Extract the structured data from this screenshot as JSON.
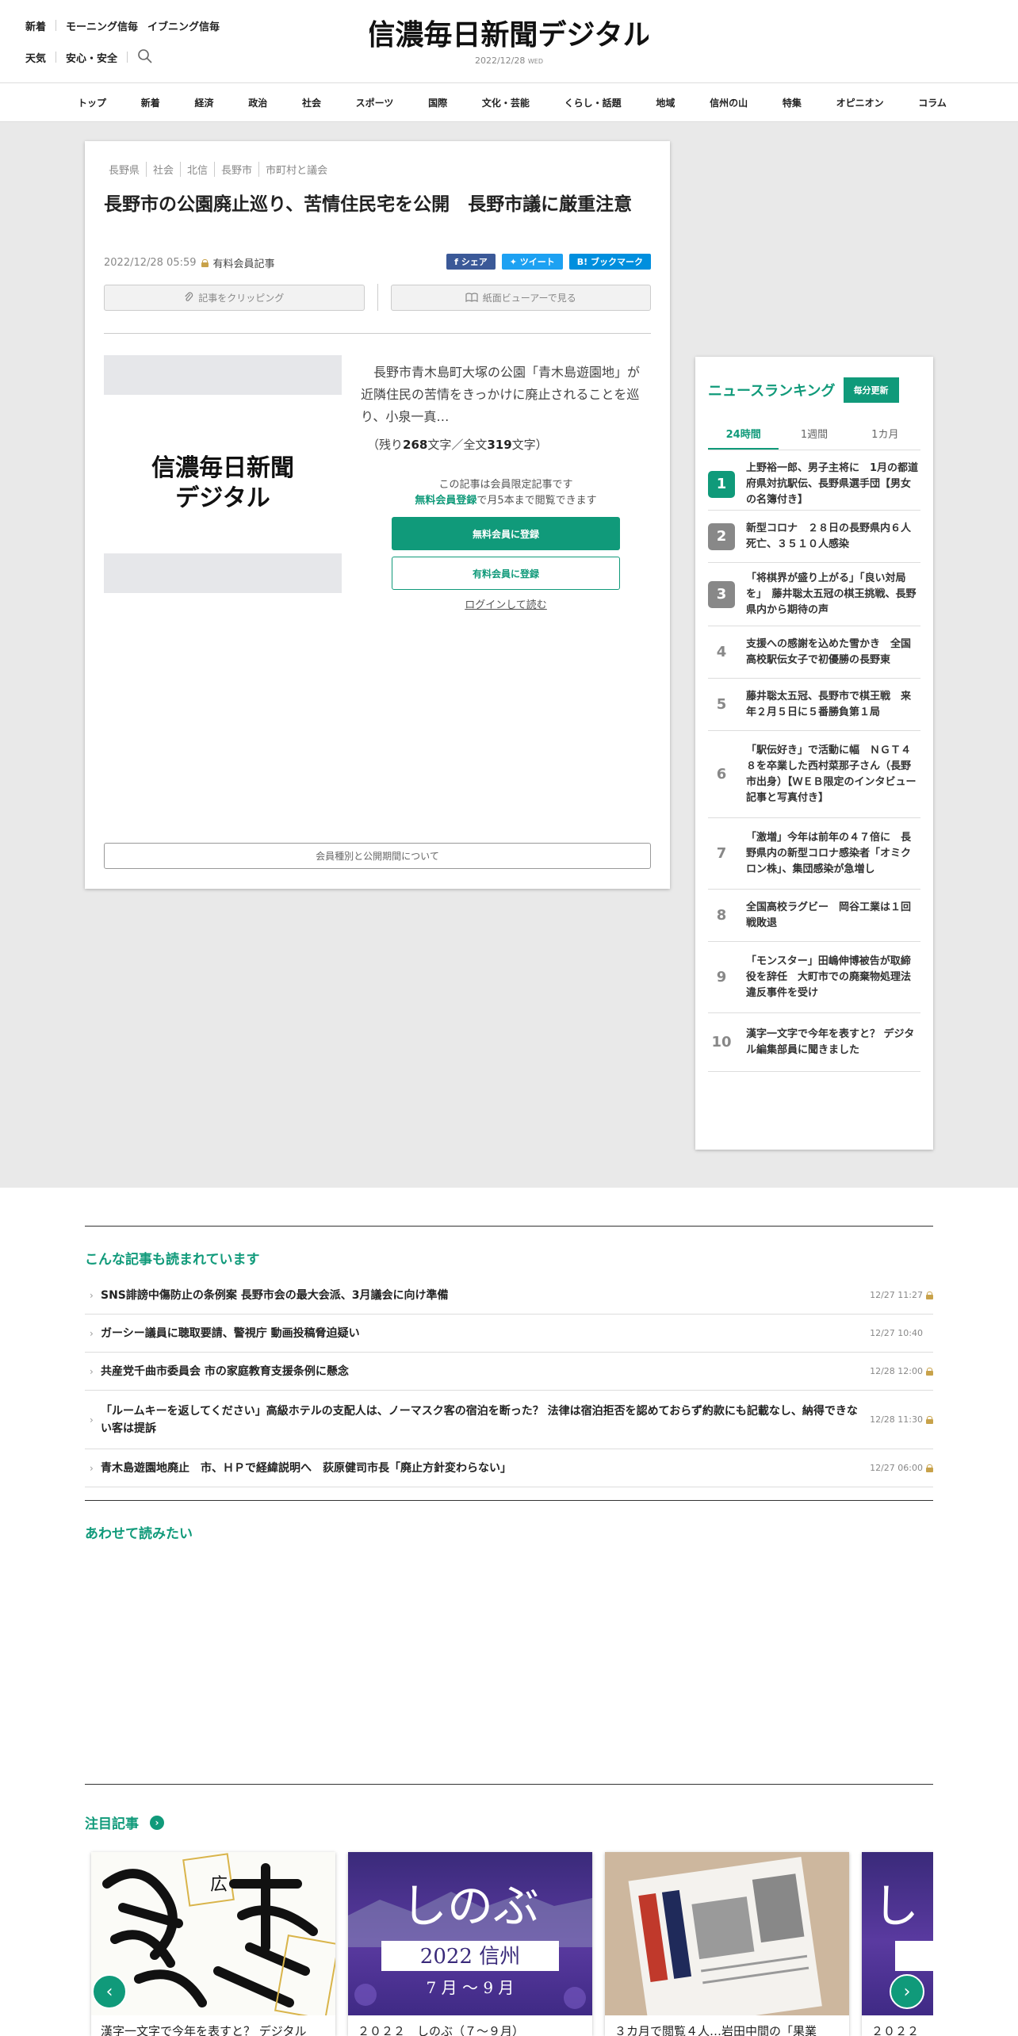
{
  "header": {
    "links_row1": [
      "新着",
      "モーニング信毎",
      "イブニング信毎"
    ],
    "links_row2": [
      "天気",
      "安心・安全"
    ],
    "logo_text": "信濃毎日新聞デジタル",
    "date": "2022/12/28",
    "weekday": "WED"
  },
  "nav": [
    "トップ",
    "新着",
    "経済",
    "政治",
    "社会",
    "スポーツ",
    "国際",
    "文化・芸能",
    "くらし・話題",
    "地域",
    "信州の山",
    "特集",
    "オピニオン",
    "コラム"
  ],
  "article": {
    "tags": [
      "長野県",
      "社会",
      "北信",
      "長野市",
      "市町村と議会"
    ],
    "headline": "長野市の公園廃止巡り、苦情住民宅を公開　長野市議に厳重注意",
    "datetime": "2022/12/28 05:59",
    "paid_label": "有料会員記事",
    "share": {
      "facebook": "シェア",
      "twitter": "ツイート",
      "hatena": "ブックマーク"
    },
    "clip_label": "記事をクリッピング",
    "viewer_label": "紙面ビューアーで見る",
    "lede": "長野市青木島町大塚の公園「青木島遊園地」が近隣住民の苦情をきっかけに廃止されることを巡り、小泉一真…",
    "remain_prefix": "（残り",
    "remain_count": "268",
    "remain_mid": "文字／全文",
    "total_count": "319",
    "remain_suffix": "文字）",
    "members_note": "この記事は会員限定記事です",
    "free_register_link": "無料会員登録",
    "free_register_suffix": "で月5本まで閲覧できます",
    "free_button": "無料会員に登録",
    "paid_button": "有料会員に登録",
    "login_link": "ログインして読む",
    "about_button": "会員種別と公開期間について"
  },
  "ranking": {
    "title": "ニュースランキング",
    "badge": "毎分更新",
    "tabs": [
      "24時間",
      "1週間",
      "1カ月"
    ],
    "items": [
      {
        "rank": "1",
        "text": "上野裕一郎、男子主将に　1月の都道府県対抗駅伝、長野県選手団【男女の名簿付き】"
      },
      {
        "rank": "2",
        "text": "新型コロナ　２８日の長野県内６人死亡、３５１０人感染"
      },
      {
        "rank": "3",
        "text": "「将棋界が盛り上がる」「良い対局を」　藤井聡太五冠の棋王挑戦、長野県内から期待の声"
      },
      {
        "rank": "4",
        "text": "支援への感謝を込めた雪かき　全国高校駅伝女子で初優勝の長野東"
      },
      {
        "rank": "5",
        "text": "藤井聡太五冠、長野市で棋王戦　来年２月５日に５番勝負第１局"
      },
      {
        "rank": "6",
        "text": "「駅伝好き」で活動に幅　ＮＧＴ４８を卒業した西村菜那子さん（長野市出身）【ＷＥＢ限定のインタビュー記事と写真付き】"
      },
      {
        "rank": "7",
        "text": "「激増」今年は前年の４７倍に　長野県内の新型コロナ感染者「オミクロン株」、集団感染が急増し"
      },
      {
        "rank": "8",
        "text": "全国高校ラグビー　岡谷工業は１回戦敗退"
      },
      {
        "rank": "9",
        "text": "「モンスター」田嶋伸博被告が取締役を辞任　大町市での廃棄物処理法違反事件を受け"
      },
      {
        "rank": "10",
        "text": "漢字一文字で今年を表すと？ デジタル編集部員に聞きました"
      }
    ]
  },
  "read_section": {
    "title": "こんな記事も読まれています",
    "items": [
      {
        "text": "SNS誹謗中傷防止の条例案 長野市会の最大会派、3月議会に向け準備",
        "date": "12/27 11:27",
        "locked": true
      },
      {
        "text": "ガーシー議員に聴取要請、警視庁 動画投稿脅迫疑い",
        "date": "12/27 10:40",
        "locked": false
      },
      {
        "text": "共産党千曲市委員会 市の家庭教育支援条例に懸念",
        "date": "12/28 12:00",
        "locked": true
      },
      {
        "text": "「ルームキーを返してください」高級ホテルの支配人は、ノーマスク客の宿泊を断った？ 法律は宿泊拒否を認めておらず約款にも記載なし、納得できない客は提訴",
        "date": "12/28 11:30",
        "locked": true
      },
      {
        "text": "青木島遊園地廃止　市、ＨＰで経緯説明へ　荻原健司市長「廃止方針変わらない」",
        "date": "12/27 06:00",
        "locked": true
      }
    ]
  },
  "also_read": {
    "title": "あわせて読みたい"
  },
  "featured": {
    "title": "注目記事",
    "cards": [
      {
        "caption": "漢字一文字で今年を表すと？ デジタル",
        "image": "calligraphy"
      },
      {
        "caption": "２０２２　しのぶ（７〜９月）",
        "image_title": "しのぶ",
        "image_year": "2022 信州",
        "image_period": "7 月 〜 9 月"
      },
      {
        "caption": "３カ月で閲覧４人…岩田中間の「果業",
        "image": "newspapers"
      },
      {
        "caption": "２０２２　し",
        "image": "shinobu2"
      }
    ]
  },
  "colors": {
    "accent": "#109a7a",
    "facebook": "#3b5998",
    "twitter": "#1da1f2",
    "hatena": "#008fde"
  }
}
